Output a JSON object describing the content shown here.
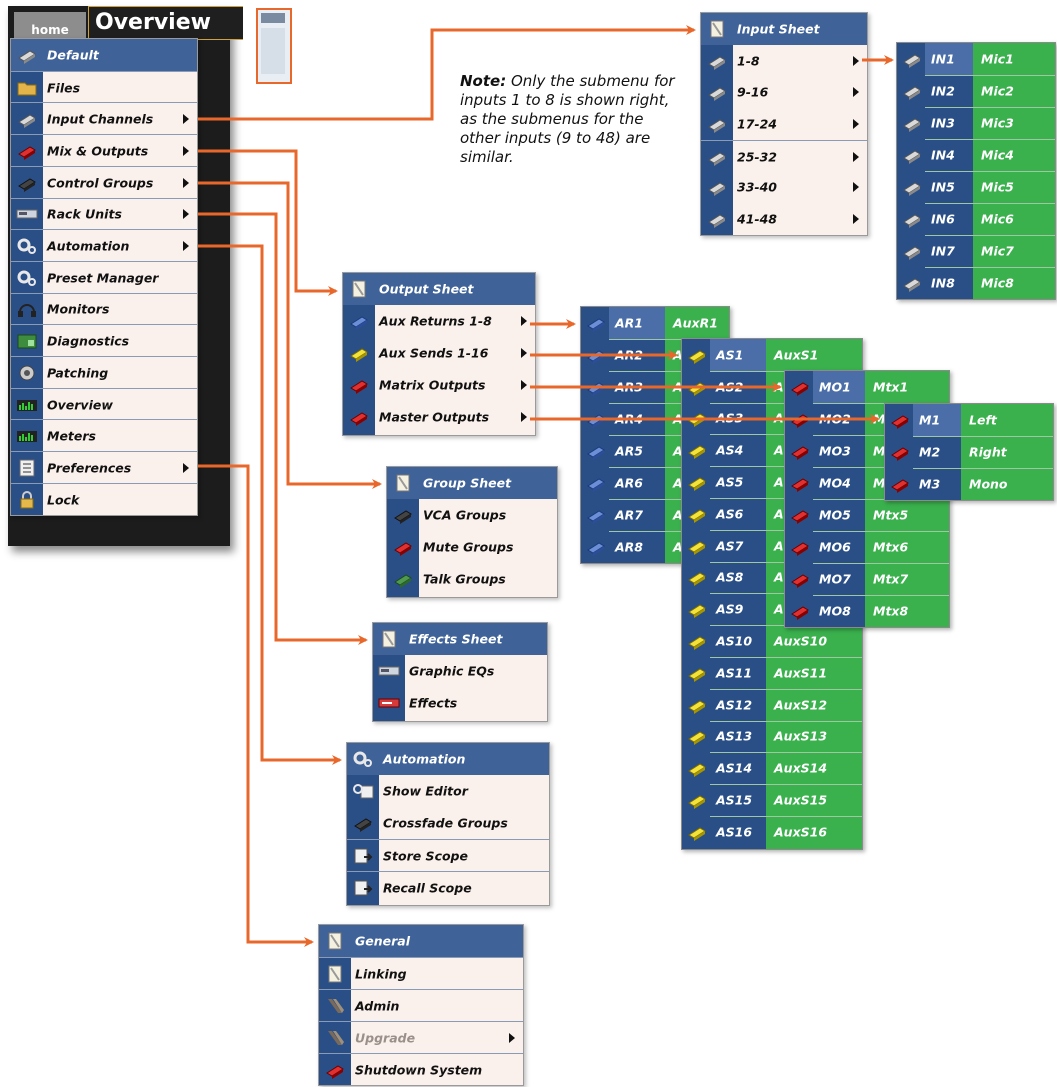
{
  "console": {
    "home_label": "home",
    "window_title": "Overview"
  },
  "note": {
    "bold": "Note:",
    "text": " Only the submenu for inputs 1 to 8 is shown right, as the submenus for the other inputs (9 to 48) are similar."
  },
  "main_menu": {
    "items": [
      {
        "label": "Default",
        "icon": "fader-icon"
      },
      {
        "label": "Files",
        "icon": "folder-icon"
      },
      {
        "label": "Input Channels",
        "icon": "fader-icon",
        "submenu": true
      },
      {
        "label": "Mix & Outputs",
        "icon": "red-fader-icon",
        "submenu": true
      },
      {
        "label": "Control Groups",
        "icon": "dark-fader-icon",
        "submenu": true
      },
      {
        "label": "Rack Units",
        "icon": "rack-icon",
        "submenu": true
      },
      {
        "label": "Automation",
        "icon": "gears-icon",
        "submenu": true
      },
      {
        "label": "Preset Manager",
        "icon": "gears-icon"
      },
      {
        "label": "Monitors",
        "icon": "headphones-icon"
      },
      {
        "label": "Diagnostics",
        "icon": "diagnostics-icon"
      },
      {
        "label": "Patching",
        "icon": "connector-icon"
      },
      {
        "label": "Overview",
        "icon": "meters-icon"
      },
      {
        "label": "Meters",
        "icon": "meters-icon"
      },
      {
        "label": "Preferences",
        "icon": "list-icon",
        "submenu": true
      },
      {
        "label": "Lock",
        "icon": "lock-icon"
      }
    ]
  },
  "input_menu": {
    "items": [
      {
        "label": "Input Sheet"
      },
      {
        "label": "1-8"
      },
      {
        "label": "9-16"
      },
      {
        "label": "17-24"
      },
      {
        "label": "25-32"
      },
      {
        "label": "33-40"
      },
      {
        "label": "41-48"
      }
    ]
  },
  "input_sub": {
    "rows": [
      {
        "id": "IN1",
        "name": "Mic1"
      },
      {
        "id": "IN2",
        "name": "Mic2"
      },
      {
        "id": "IN3",
        "name": "Mic3"
      },
      {
        "id": "IN4",
        "name": "Mic4"
      },
      {
        "id": "IN5",
        "name": "Mic5"
      },
      {
        "id": "IN6",
        "name": "Mic6"
      },
      {
        "id": "IN7",
        "name": "Mic7"
      },
      {
        "id": "IN8",
        "name": "Mic8"
      }
    ]
  },
  "output_menu": {
    "items": [
      {
        "label": "Output Sheet"
      },
      {
        "label": "Aux Returns 1-8"
      },
      {
        "label": "Aux Sends 1-16"
      },
      {
        "label": "Matrix Outputs"
      },
      {
        "label": "Master Outputs"
      }
    ]
  },
  "ar_sub": {
    "rows": [
      {
        "id": "AR1",
        "name": "AuxR1"
      },
      {
        "id": "AR2",
        "name": "A"
      },
      {
        "id": "AR3",
        "name": "A"
      },
      {
        "id": "AR4",
        "name": "A"
      },
      {
        "id": "AR5",
        "name": "A"
      },
      {
        "id": "AR6",
        "name": "A"
      },
      {
        "id": "AR7",
        "name": "A"
      },
      {
        "id": "AR8",
        "name": "A"
      }
    ]
  },
  "as_sub": {
    "rows": [
      {
        "id": "AS1",
        "name": "AuxS1"
      },
      {
        "id": "AS2",
        "name": "Au"
      },
      {
        "id": "AS3",
        "name": "Au"
      },
      {
        "id": "AS4",
        "name": "Au"
      },
      {
        "id": "AS5",
        "name": "Au"
      },
      {
        "id": "AS6",
        "name": "Au"
      },
      {
        "id": "AS7",
        "name": "Au"
      },
      {
        "id": "AS8",
        "name": "Au"
      },
      {
        "id": "AS9",
        "name": "Au"
      },
      {
        "id": "AS10",
        "name": "AuxS10"
      },
      {
        "id": "AS11",
        "name": "AuxS11"
      },
      {
        "id": "AS12",
        "name": "AuxS12"
      },
      {
        "id": "AS13",
        "name": "AuxS13"
      },
      {
        "id": "AS14",
        "name": "AuxS14"
      },
      {
        "id": "AS15",
        "name": "AuxS15"
      },
      {
        "id": "AS16",
        "name": "AuxS16"
      }
    ]
  },
  "mo_sub": {
    "rows": [
      {
        "id": "MO1",
        "name": "Mtx1"
      },
      {
        "id": "MO2",
        "name": "M"
      },
      {
        "id": "MO3",
        "name": "M"
      },
      {
        "id": "MO4",
        "name": "M"
      },
      {
        "id": "MO5",
        "name": "Mtx5"
      },
      {
        "id": "MO6",
        "name": "Mtx6"
      },
      {
        "id": "MO7",
        "name": "Mtx7"
      },
      {
        "id": "MO8",
        "name": "Mtx8"
      }
    ]
  },
  "m_sub": {
    "rows": [
      {
        "id": "M1",
        "name": "Left"
      },
      {
        "id": "M2",
        "name": "Right"
      },
      {
        "id": "M3",
        "name": "Mono"
      }
    ]
  },
  "group_menu": {
    "items": [
      {
        "label": "Group Sheet"
      },
      {
        "label": "VCA Groups"
      },
      {
        "label": "Mute Groups"
      },
      {
        "label": "Talk Groups"
      }
    ]
  },
  "effects_menu": {
    "items": [
      {
        "label": "Effects Sheet"
      },
      {
        "label": "Graphic EQs"
      },
      {
        "label": "Effects"
      }
    ]
  },
  "automation_menu": {
    "items": [
      {
        "label": "Automation"
      },
      {
        "label": "Show Editor"
      },
      {
        "label": "Crossfade Groups"
      },
      {
        "label": "Store Scope"
      },
      {
        "label": "Recall Scope"
      }
    ]
  },
  "prefs_menu": {
    "items": [
      {
        "label": "General"
      },
      {
        "label": "Linking"
      },
      {
        "label": "Admin"
      },
      {
        "label": "Upgrade",
        "disabled": true
      },
      {
        "label": "Shutdown System"
      }
    ]
  },
  "colors": {
    "accent": "#e8672a",
    "menu_header": "#3f6298",
    "icon_column": "#2a4f87",
    "value_green": "#3ab14d",
    "menu_bg": "#fbf1ec"
  }
}
